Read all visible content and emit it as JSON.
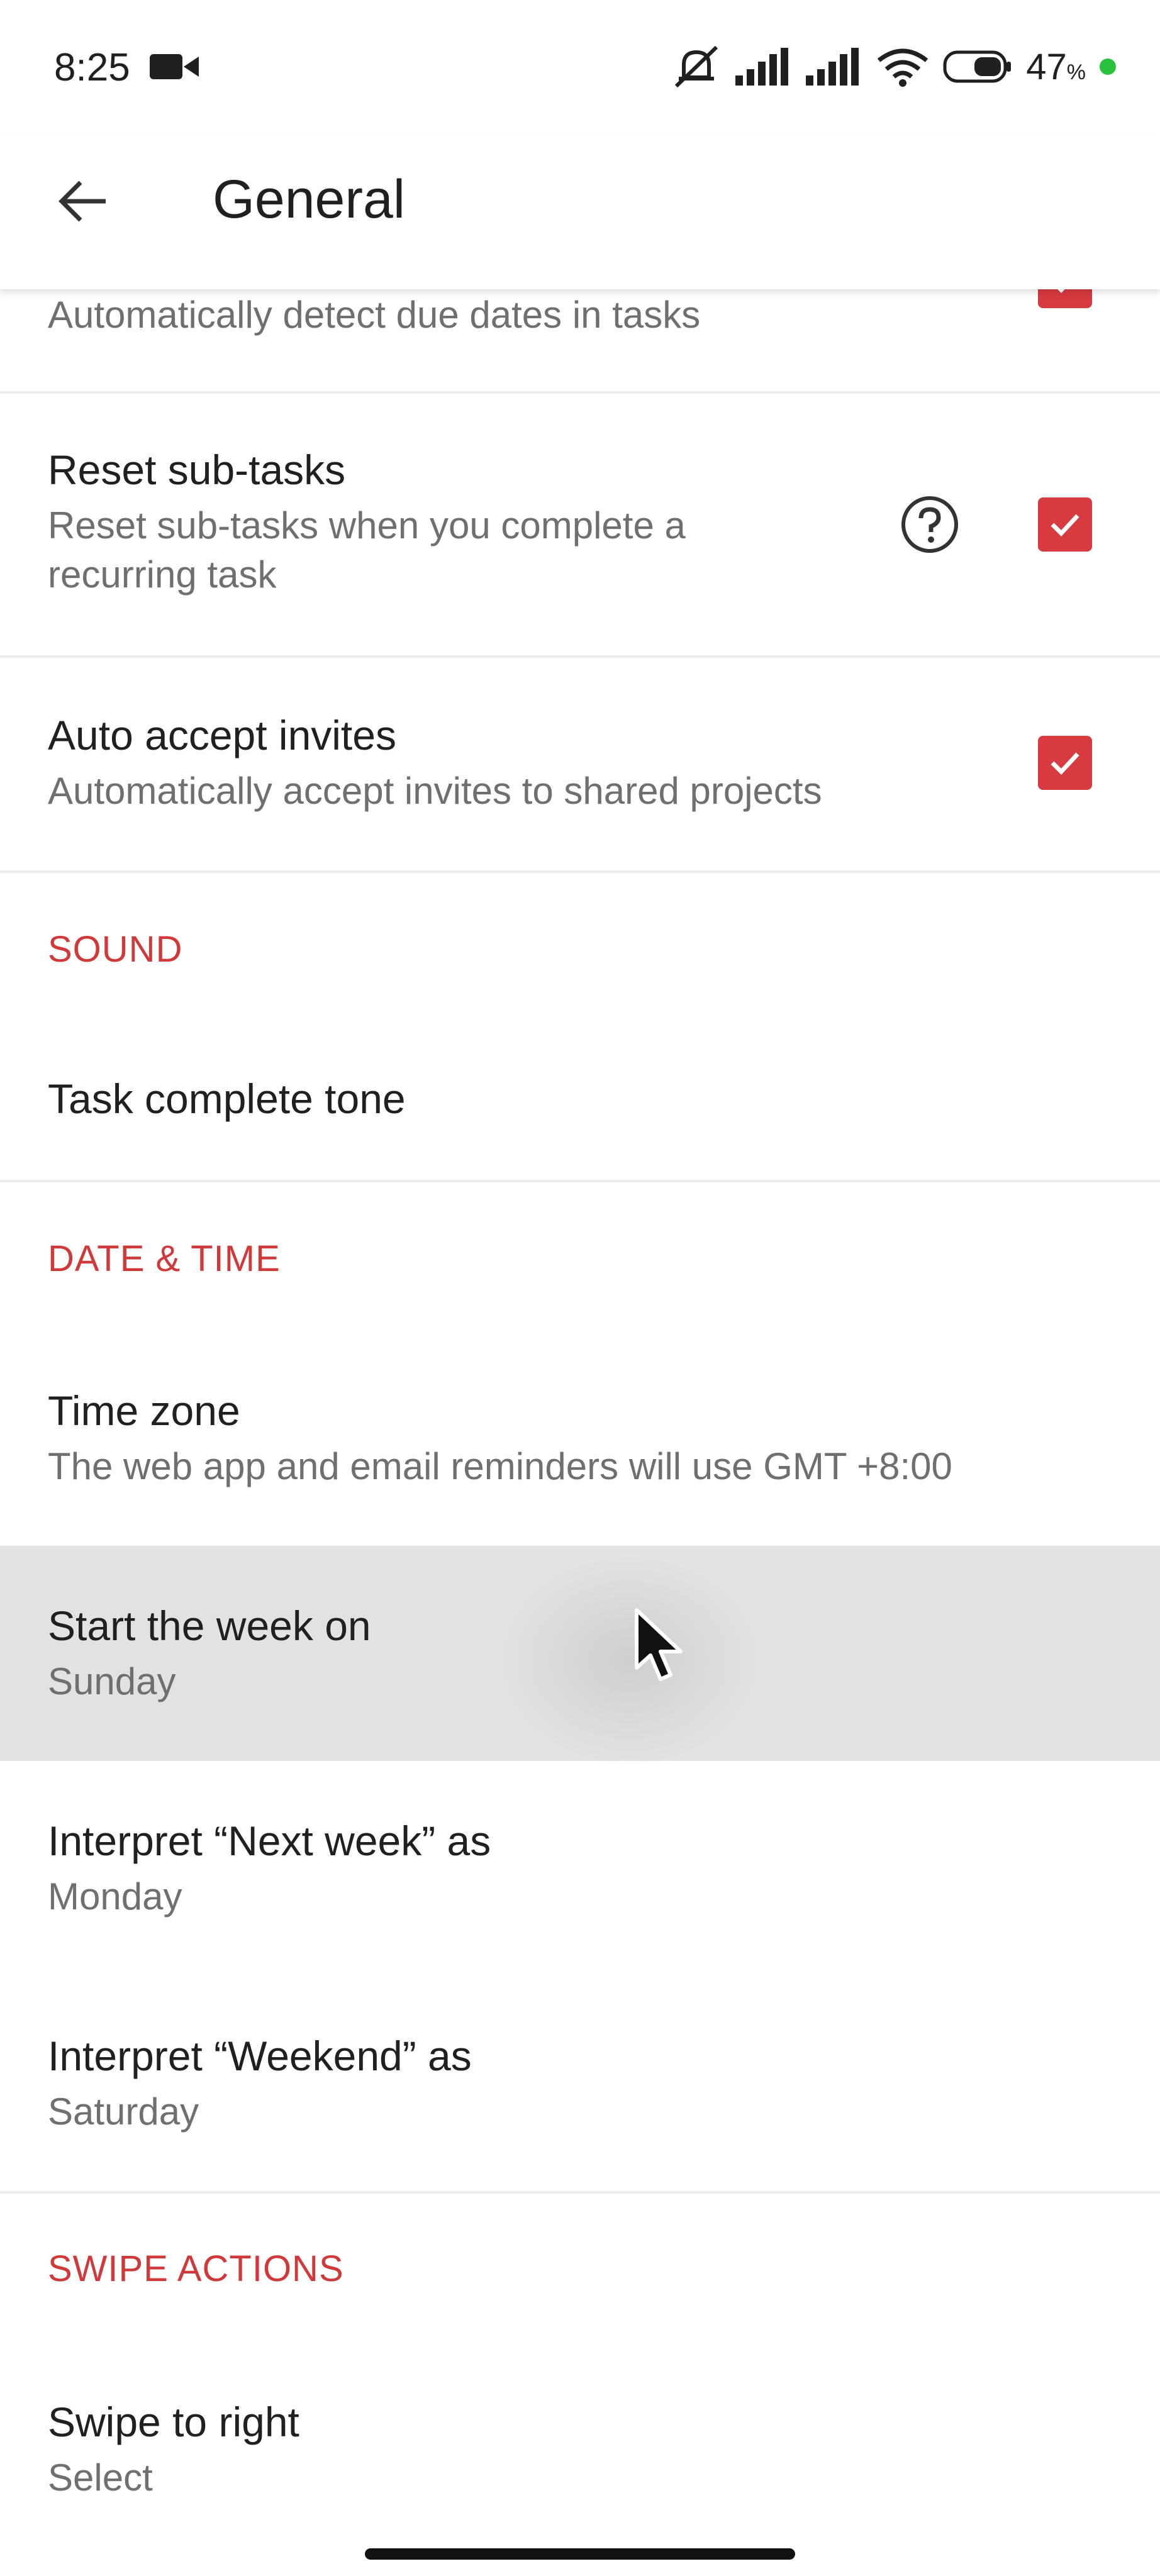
{
  "status_bar": {
    "time": "8:25",
    "battery_percent": "47",
    "battery_unit": "%"
  },
  "app_bar": {
    "title": "General",
    "back_icon": "arrow-left-icon"
  },
  "settings": {
    "smart_date_subtitle": "Automatically detect due dates in tasks",
    "reset_subtasks": {
      "title": "Reset sub-tasks",
      "subtitle_line1": "Reset sub-tasks when you complete a",
      "subtitle_line2": "recurring task",
      "checked": true
    },
    "auto_accept": {
      "title": "Auto accept invites",
      "subtitle": "Automatically accept invites to shared projects",
      "checked": true
    },
    "sound_header": "SOUND",
    "task_complete_tone": "Task complete tone",
    "date_time_header": "DATE & TIME",
    "time_zone": {
      "title": "Time zone",
      "subtitle": "The web app and email reminders will use GMT +8:00"
    },
    "start_week": {
      "title": "Start the week on",
      "value": "Sunday"
    },
    "next_week": {
      "title": "Interpret “Next week” as",
      "value": "Monday"
    },
    "weekend": {
      "title": "Interpret “Weekend” as",
      "value": "Saturday"
    },
    "swipe_header": "SWIPE ACTIONS",
    "swipe_right": {
      "title": "Swipe to right",
      "value": "Select"
    }
  },
  "colors": {
    "accent": "#d1383a",
    "checkbox": "#d73a3f",
    "pressed_row": "#e2e2e2"
  }
}
